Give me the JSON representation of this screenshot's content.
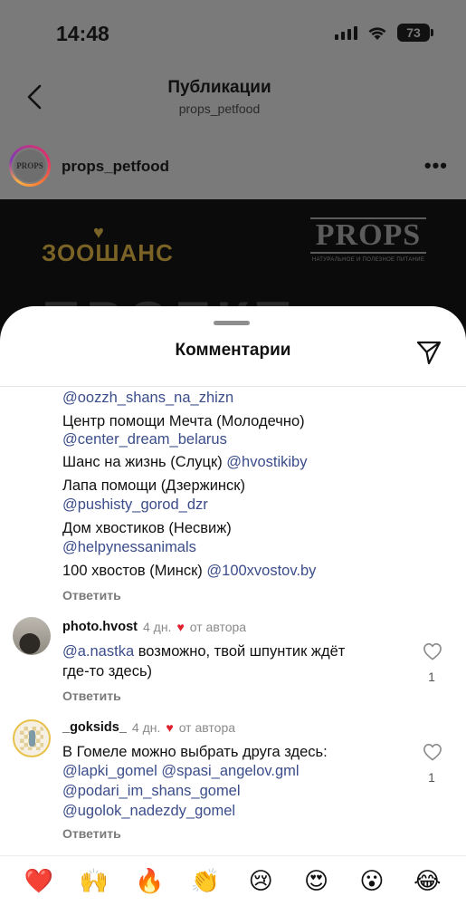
{
  "status_bar": {
    "time": "14:48",
    "battery": "73"
  },
  "header": {
    "title": "Публикации",
    "subtitle": "props_petfood"
  },
  "post": {
    "username": "props_petfood",
    "more_label": "•••",
    "avatar_text": "PROPS",
    "image": {
      "left_logo": "ЗООШАНС",
      "right_logo": "PROPS",
      "right_logo_tagline": "НАТУРАЛЬНОЕ И ПОЛЕЗНОЕ ПИТАНИЕ",
      "big_text": "ПРОЕКТ"
    }
  },
  "sheet": {
    "title": "Комментарии",
    "first_comment": {
      "lines": [
        {
          "mention": "@oozzh_shans_na_zhizn"
        },
        {
          "text": "Центр помощи Мечта (Молодечно)"
        },
        {
          "mention": "@center_dream_belarus"
        },
        {
          "text": "Шанс на жизнь (Слуцк) ",
          "mention": "@hvostikiby"
        },
        {
          "text": "Лапа помощи (Дзержинск)"
        },
        {
          "mention": "@pushisty_gorod_dzr"
        },
        {
          "text": "Дом хвостиков (Несвиж)"
        },
        {
          "mention": "@helpynessanimals"
        },
        {
          "text": "100 хвостов (Минск) ",
          "mention": "@100xvostov.by"
        }
      ],
      "reply_label": "Ответить"
    },
    "comments": [
      {
        "username": "photo.hvost",
        "time": "4 дн.",
        "author_label": "от автора",
        "mention": "@a.nastka",
        "text_line1": " возможно, твой шпунтик ждёт",
        "text_line2": "где-то здесь)",
        "likes": "1",
        "reply_label": "Ответить"
      },
      {
        "username": "_goksids_",
        "time": "4 дн.",
        "author_label": "от автора",
        "text_line1": "В Гомеле можно выбрать друга здесь:",
        "mention_a": "@lapki_gomel",
        "mention_b": "@spasi_angelov.gml",
        "mention_c": "@podari_im_shans_gomel",
        "mention_d": "@ugolok_nadezdy_gomel",
        "likes": "1",
        "reply_label": "Ответить"
      }
    ]
  },
  "emoji_bar": {
    "items": [
      {
        "name": "heart-emoji",
        "char": "❤️"
      },
      {
        "name": "raising-hands-emoji",
        "char": "🙌"
      },
      {
        "name": "fire-emoji",
        "char": "🔥"
      },
      {
        "name": "clapping-hands-emoji",
        "char": "👏"
      },
      {
        "name": "crying-face-emoji",
        "char": "😢"
      },
      {
        "name": "heart-eyes-emoji",
        "char": "😍"
      },
      {
        "name": "astonished-face-emoji",
        "char": "😮"
      },
      {
        "name": "tears-of-joy-emoji",
        "char": "😂"
      }
    ]
  },
  "colors": {
    "mention": "#3b4d8a",
    "author_heart": "#e0222f",
    "overlay": "#7a7a7a",
    "sheet_bg": "#ffffff"
  }
}
